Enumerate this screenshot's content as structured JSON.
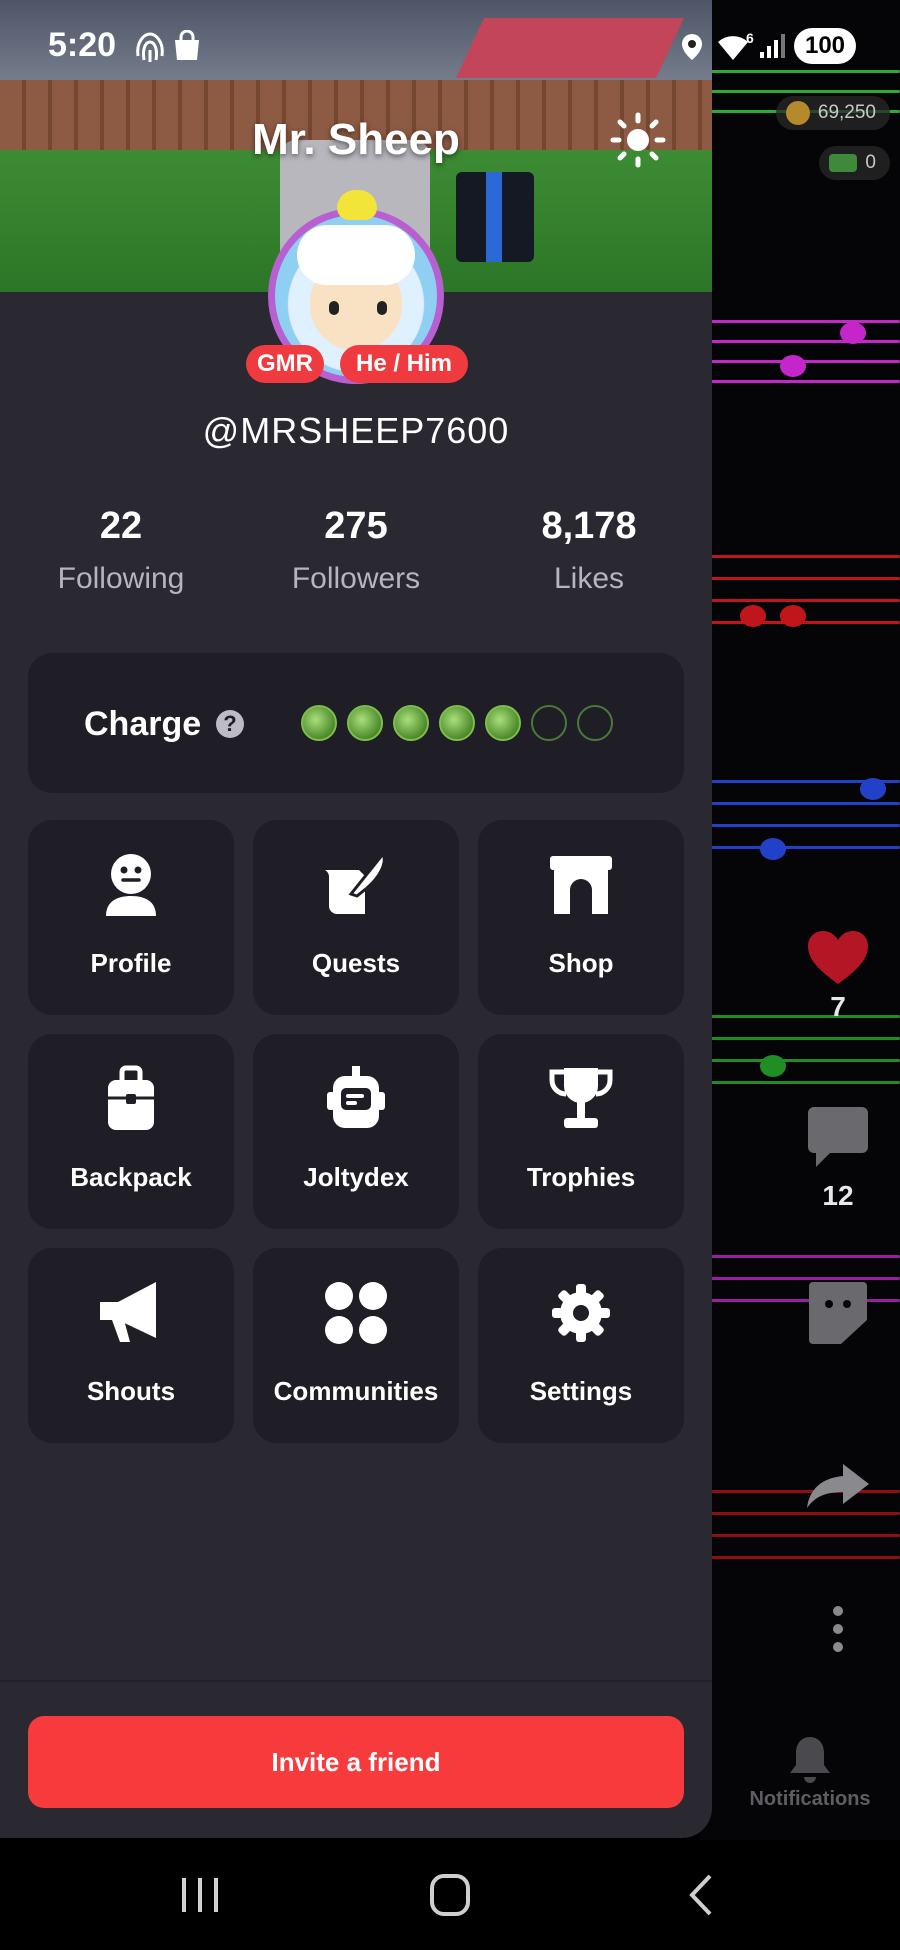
{
  "status_bar": {
    "time": "5:20",
    "battery": "100",
    "network": "6"
  },
  "feed": {
    "coins": "69,250",
    "cash": "0",
    "like_count": "7",
    "comment_count": "12",
    "notifications_label": "Notifications"
  },
  "profile": {
    "display_name": "Mr. Sheep",
    "username": "@MRSHEEP7600",
    "badges": [
      "GMR",
      "He / Him"
    ],
    "stats": [
      {
        "value": "22",
        "label": "Following"
      },
      {
        "value": "275",
        "label": "Followers"
      },
      {
        "value": "8,178",
        "label": "Likes"
      }
    ],
    "charge": {
      "label": "Charge",
      "filled": 5,
      "total": 7
    }
  },
  "menu": [
    {
      "label": "Profile",
      "icon": "person-icon"
    },
    {
      "label": "Quests",
      "icon": "quill-scroll-icon"
    },
    {
      "label": "Shop",
      "icon": "storefront-icon"
    },
    {
      "label": "Backpack",
      "icon": "backpack-icon"
    },
    {
      "label": "Joltydex",
      "icon": "robot-head-icon"
    },
    {
      "label": "Trophies",
      "icon": "trophy-icon"
    },
    {
      "label": "Shouts",
      "icon": "megaphone-icon"
    },
    {
      "label": "Communities",
      "icon": "four-circles-icon"
    },
    {
      "label": "Settings",
      "icon": "gear-icon"
    }
  ],
  "invite_button": "Invite a friend",
  "colors": {
    "accent": "#f73b3d",
    "drawer_bg": "#2a2830",
    "tile_bg": "#1f1d26"
  }
}
